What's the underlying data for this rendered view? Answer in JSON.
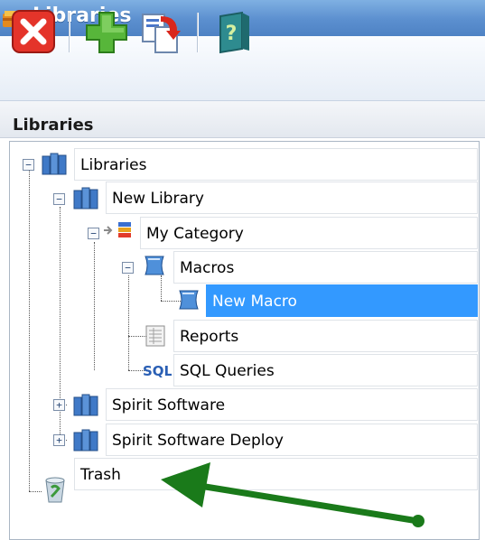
{
  "window": {
    "title": "Libraries"
  },
  "toolbar": {
    "buttons": [
      {
        "icon": "delete-icon"
      },
      {
        "icon": "add-icon"
      },
      {
        "icon": "export-icon"
      },
      {
        "icon": "help-book-icon"
      }
    ]
  },
  "panel": {
    "title": "Libraries"
  },
  "tree": {
    "root": "Libraries",
    "library": "New Library",
    "category": "My Category",
    "macros": "Macros",
    "new_macro": "New Macro",
    "reports": "Reports",
    "sql_queries": "SQL Queries",
    "spirit_software": "Spirit Software",
    "spirit_software_deploy": "Spirit Software Deploy",
    "trash": "Trash",
    "selected": "New Macro"
  },
  "colors": {
    "selection": "#3399ff",
    "arrow": "#1a7a1a",
    "titlebar": "#5b8fcf"
  }
}
